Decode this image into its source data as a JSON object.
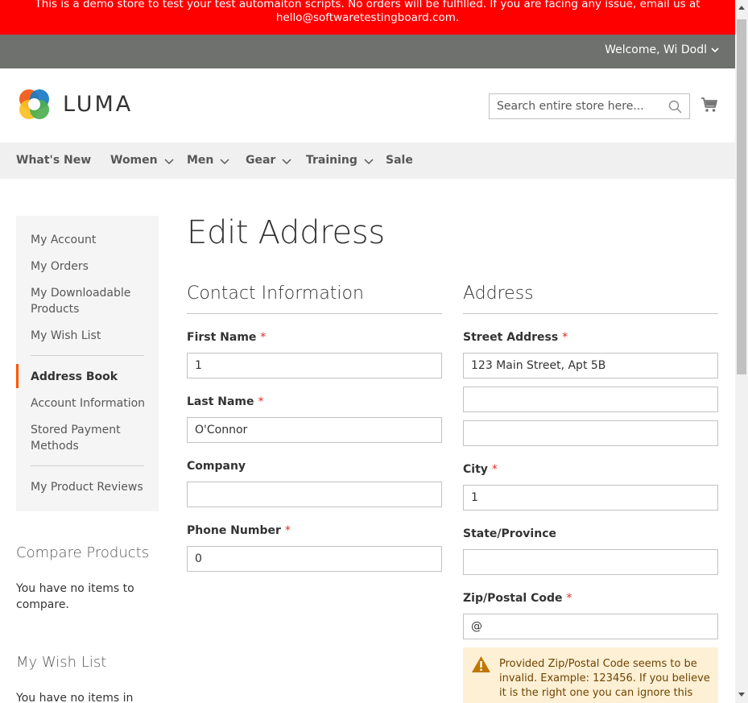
{
  "banner": {
    "line1": "This is a demo store to test your test automaiton scripts. No orders will be fulfilled. If you are facing any issue, email us at",
    "line2": "hello@softwaretestingboard.com."
  },
  "header": {
    "welcome": "Welcome, Wi Dodl",
    "logo_text": "LUMA",
    "search_placeholder": "Search entire store here...",
    "icons": {
      "search": "search-icon",
      "cart": "cart-icon",
      "dropdown": "chevron-down-icon"
    }
  },
  "nav": {
    "items": [
      {
        "label": "What's New",
        "has_dropdown": false
      },
      {
        "label": "Women",
        "has_dropdown": true
      },
      {
        "label": "Men",
        "has_dropdown": true
      },
      {
        "label": "Gear",
        "has_dropdown": true
      },
      {
        "label": "Training",
        "has_dropdown": true
      },
      {
        "label": "Sale",
        "has_dropdown": false
      }
    ]
  },
  "sidebar": {
    "items": [
      {
        "label": "My Account"
      },
      {
        "label": "My Orders"
      },
      {
        "label": "My Downloadable Products"
      },
      {
        "label": "My Wish List"
      },
      {
        "label": "Address Book",
        "active": true
      },
      {
        "label": "Account Information"
      },
      {
        "label": "Stored Payment Methods"
      },
      {
        "label": "My Product Reviews"
      }
    ],
    "compare": {
      "title": "Compare Products",
      "text": "You have no items to compare."
    },
    "wishlist": {
      "title": "My Wish List",
      "text": "You have no items in your"
    }
  },
  "main": {
    "title": "Edit Address",
    "contact": {
      "section_title": "Contact Information",
      "first_name": {
        "label": "First Name",
        "value": "1",
        "required": true
      },
      "last_name": {
        "label": "Last Name",
        "value": "O'Connor",
        "required": true
      },
      "company": {
        "label": "Company",
        "value": "",
        "required": false
      },
      "phone": {
        "label": "Phone Number",
        "value": "0",
        "required": true
      }
    },
    "address": {
      "section_title": "Address",
      "street": {
        "label": "Street Address",
        "value": "123 Main Street, Apt 5B",
        "line2": "",
        "line3": "",
        "required": true
      },
      "city": {
        "label": "City",
        "value": "1",
        "required": true
      },
      "state": {
        "label": "State/Province",
        "value": "",
        "required": false
      },
      "zip": {
        "label": "Zip/Postal Code",
        "value": "@",
        "required": true
      },
      "zip_warning": "Provided Zip/Postal Code seems to be invalid. Example: 123456. If you believe it is the right one you can ignore this"
    },
    "required_mark": "*"
  },
  "colors": {
    "banner": "#ff0000",
    "topbar": "#6e716e",
    "nav_bg": "#f0f0f0",
    "sidebar_bg": "#f5f5f5",
    "active_accent": "#ff5501",
    "required": "#e02b27",
    "warning_bg": "#fdf0d5",
    "warning_icon": "#c07600"
  }
}
